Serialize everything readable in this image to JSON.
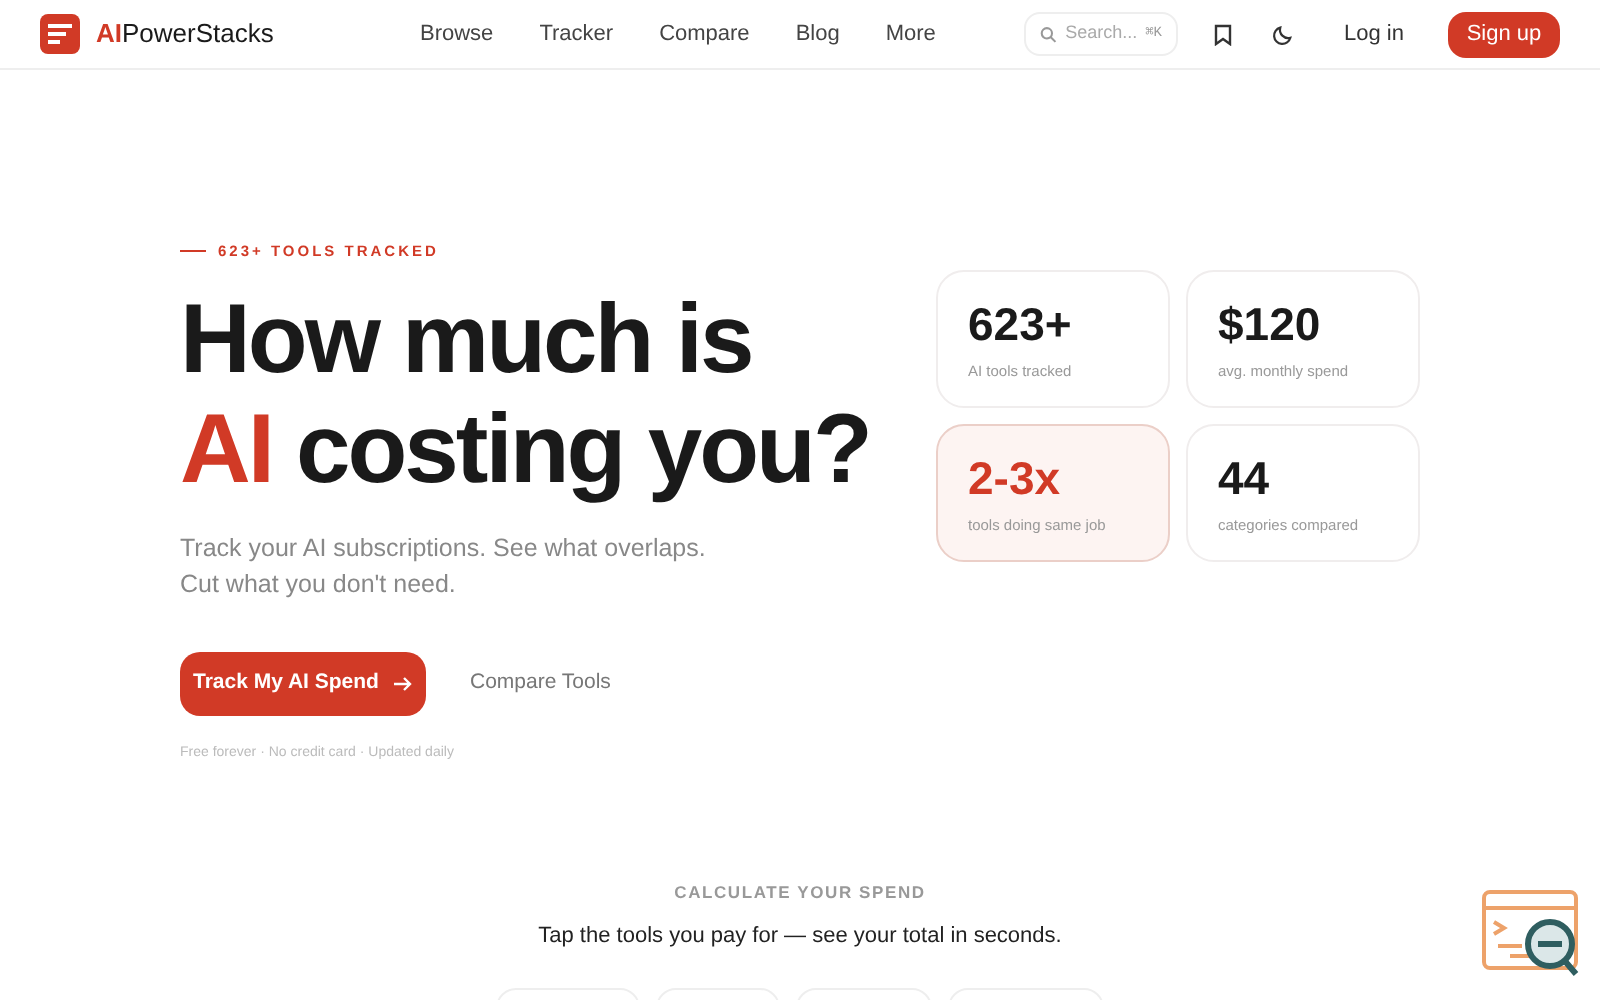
{
  "brand": {
    "prefix": "AI",
    "name": "PowerStacks"
  },
  "nav": [
    "Browse",
    "Tracker",
    "Compare",
    "Blog",
    "More"
  ],
  "search": {
    "placeholder": "Search...",
    "shortcut": "⌘K"
  },
  "actions": {
    "login": "Log in",
    "signup": "Sign up"
  },
  "hero": {
    "eyebrow": "623+ TOOLS TRACKED",
    "headline_1": "How much is",
    "headline_accent": "AI",
    "headline_2": "costing you?",
    "subtitle": "Track your AI subscriptions. See what overlaps. Cut what you don't need.",
    "primary": "Track My AI Spend",
    "secondary": "Compare Tools",
    "note": "Free forever · No credit card · Updated daily"
  },
  "stats": [
    {
      "value": "623+",
      "label": "AI tools tracked",
      "highlighted": false
    },
    {
      "value": "$120",
      "label": "avg. monthly spend",
      "highlighted": false
    },
    {
      "value": "2-3x",
      "label": "tools doing same job",
      "highlighted": true
    },
    {
      "value": "44",
      "label": "categories compared",
      "highlighted": false
    }
  ],
  "calculator": {
    "eyebrow": "CALCULATE YOUR SPEND",
    "title": "Tap the tools you pay for — see your total in seconds.",
    "chips": [
      {
        "kind": "chip"
      },
      {
        "kind": "chip"
      },
      {
        "kind": "chip"
      },
      {
        "kind": "chip"
      }
    ]
  }
}
